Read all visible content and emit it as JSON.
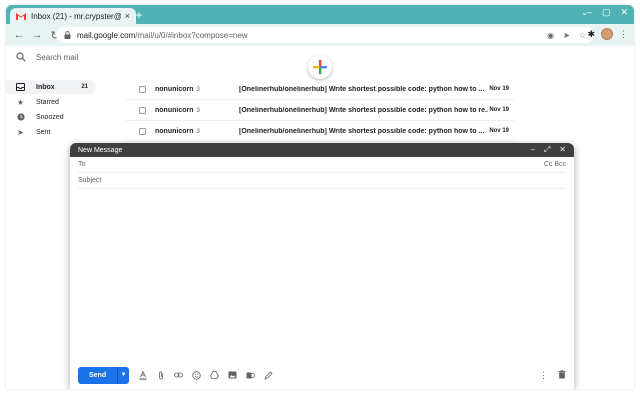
{
  "browser": {
    "tab_title": "Inbox (21) - mr.crypster@",
    "tab_close": "×",
    "new_tab": "+",
    "url_host": "mail.google.com",
    "url_path": "/mail/u/0/#inbox?compose=new",
    "accent": "#4fb3b6"
  },
  "gmail": {
    "search_placeholder": "Search mail",
    "sidebar": [
      {
        "label": "Inbox",
        "count": "21",
        "icon": "inbox-icon"
      },
      {
        "label": "Starred",
        "count": "",
        "icon": "star-icon"
      },
      {
        "label": "Snoozed",
        "count": "",
        "icon": "clock-icon"
      },
      {
        "label": "Sent",
        "count": "",
        "icon": "send-icon"
      }
    ],
    "emails": [
      {
        "sender": "nonunicorn",
        "count": "3",
        "subject": "[Onelinerhub/onelinerhub] Write shortest possible code: python how to ...",
        "date": "Nov 19"
      },
      {
        "sender": "nonunicorn",
        "count": "3",
        "subject": "[Onelinerhub/onelinerhub] Write shortest possible code: python how to re...",
        "date": "Nov 19"
      },
      {
        "sender": "nonunicorn",
        "count": "3",
        "subject": "[Onelinerhub/onelinerhub] Write shortest possible code: python how to ...",
        "date": "Nov 19"
      }
    ]
  },
  "compose": {
    "title": "New Message",
    "to_label": "To",
    "cc_bcc": "Cc Bcc",
    "subject_label": "Subject",
    "send_label": "Send",
    "send_color": "#1a73e8"
  }
}
